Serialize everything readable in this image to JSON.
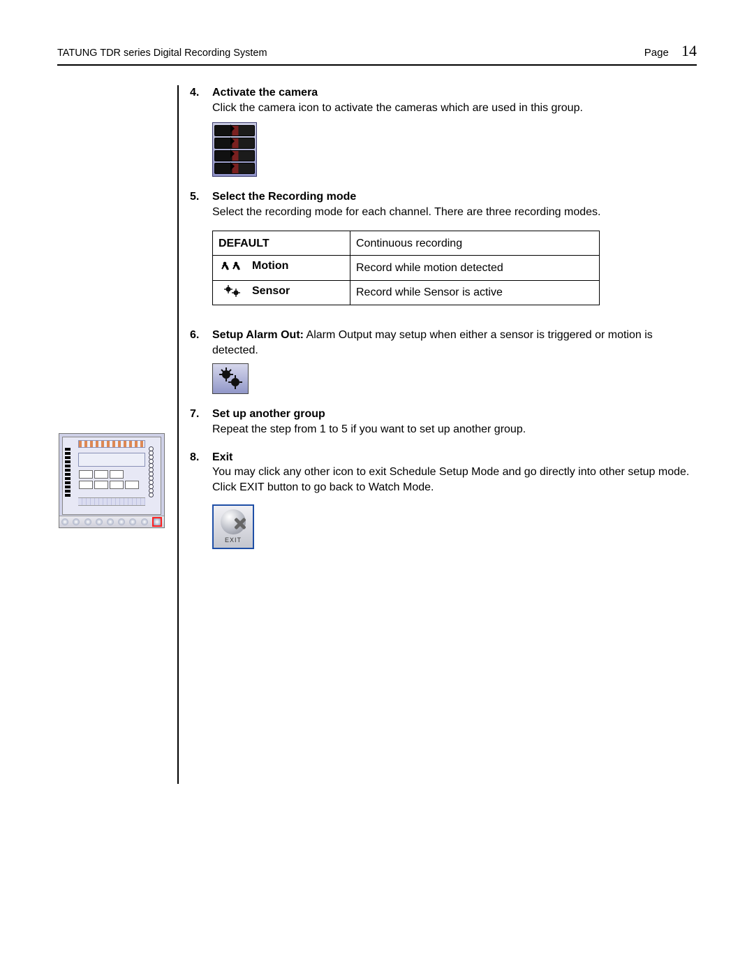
{
  "header": {
    "doc_title": "TATUNG TDR series Digital Recording System",
    "page_label": "Page",
    "page_number": "14"
  },
  "steps": {
    "s4": {
      "num": "4.",
      "title": "Activate the camera",
      "text": "Click the camera icon to activate the cameras which are used in this group."
    },
    "s5": {
      "num": "5.",
      "title": "Select the Recording mode",
      "text": "Select the recording mode for each channel. There are three recording modes."
    },
    "s6": {
      "num": "6.",
      "title": "Setup Alarm Out:",
      "text": "  Alarm Output may setup when either a sensor is triggered or motion is detected."
    },
    "s7": {
      "num": "7.",
      "title": "Set up another group",
      "text": "Repeat the step from 1 to 5 if you want to set up another group."
    },
    "s8": {
      "num": "8.",
      "title": "Exit",
      "text": "You may click any other icon to exit Schedule Setup Mode and go directly into other setup mode. Click EXIT button to go back to Watch Mode."
    }
  },
  "modes_table": {
    "r1": {
      "label": "DEFAULT",
      "desc": "Continuous recording"
    },
    "r2": {
      "label": "Motion",
      "desc": "Record while motion detected"
    },
    "r3": {
      "label": "Sensor",
      "desc": "Record while Sensor is active"
    }
  },
  "exit_button": {
    "label": "EXIT"
  }
}
